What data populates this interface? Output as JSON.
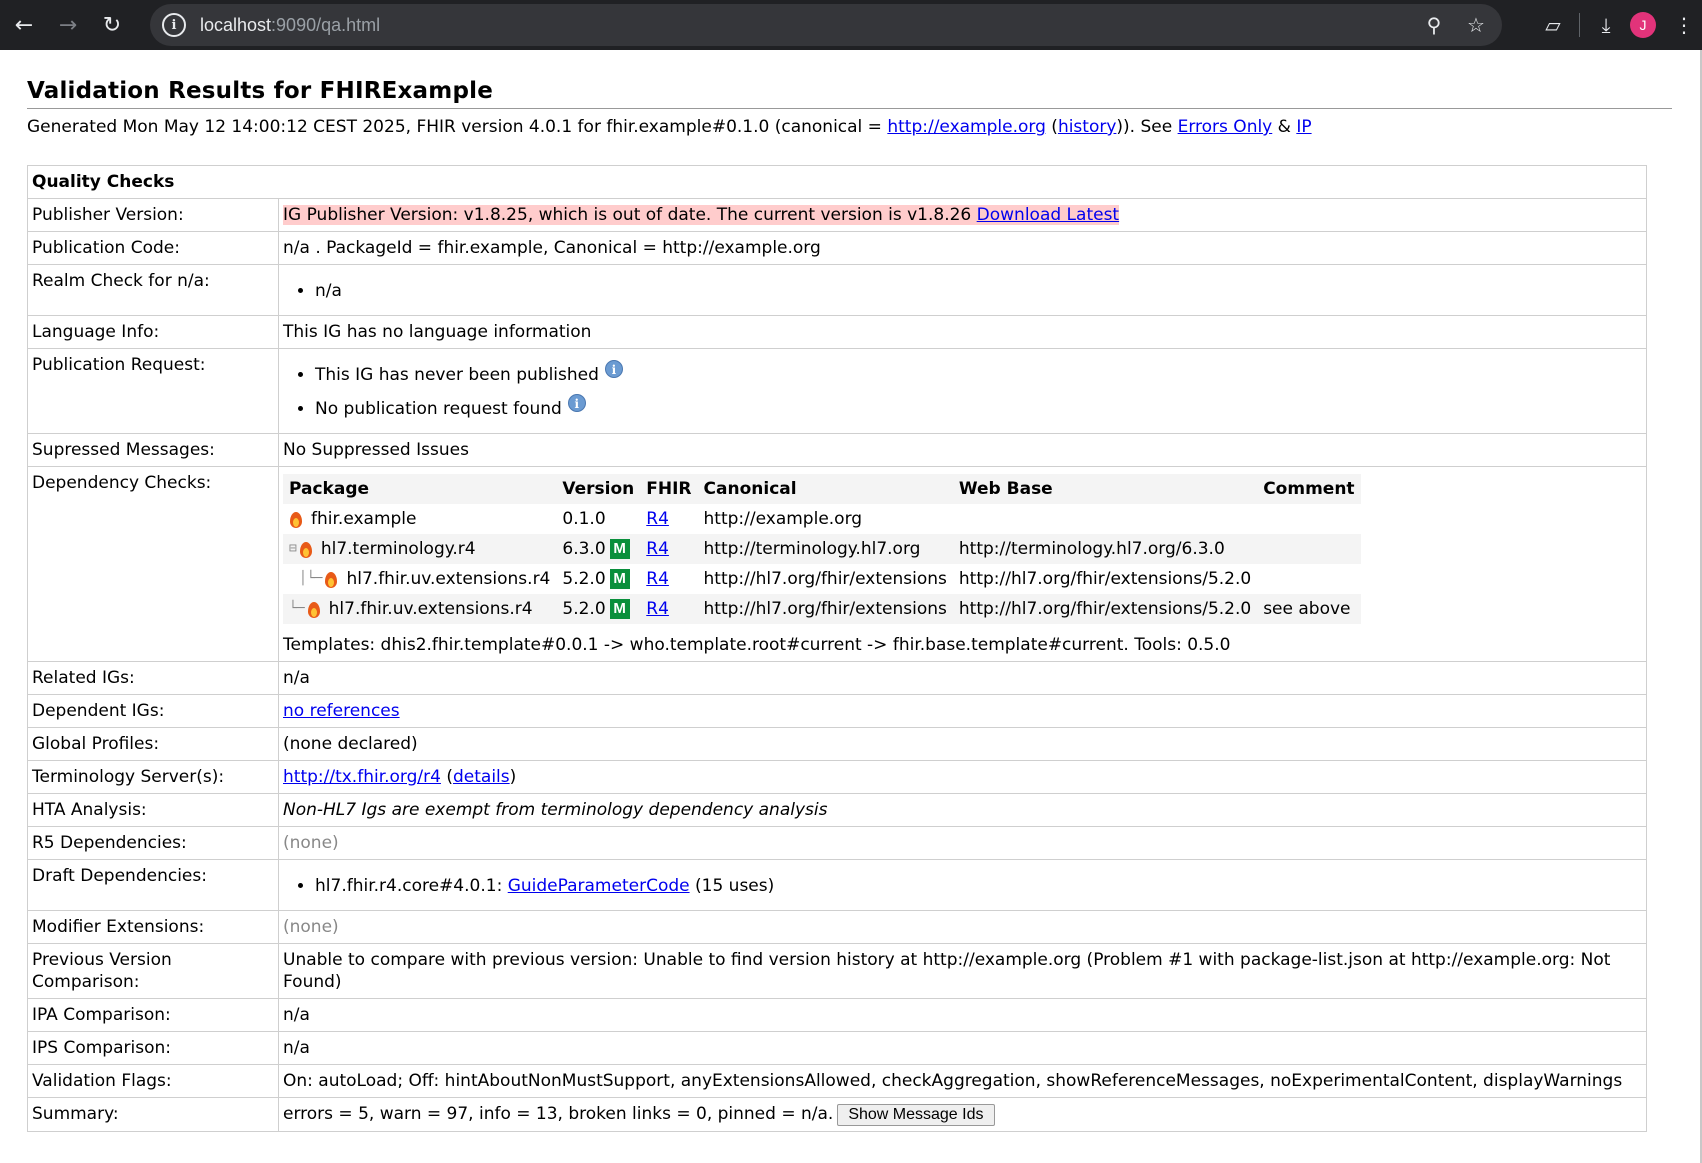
{
  "browser": {
    "url_host": "localhost",
    "url_rest": ":9090/qa.html",
    "avatar_letter": "J"
  },
  "page": {
    "title": "Validation Results for FHIRExample",
    "generated_prefix": "Generated Mon May 12 14:00:12 CEST 2025, FHIR version 4.0.1 for fhir.example#0.1.0 (canonical = ",
    "canonical_link": "http://example.org",
    "sep1": " (",
    "history_link": "history",
    "sep2": ")). See ",
    "errors_only_link": "Errors Only",
    "amp": " & ",
    "ip_link": "IP"
  },
  "quality": {
    "header": "Quality Checks",
    "publisher_version": {
      "label": "Publisher Version:",
      "text": "IG Publisher Version: v1.8.25, which is out of date. The current version is v1.8.26 ",
      "link": "Download Latest"
    },
    "publication_code": {
      "label": "Publication Code:",
      "text": "n/a . PackageId = fhir.example, Canonical = http://example.org"
    },
    "realm_check": {
      "label": "Realm Check for n/a:",
      "items": [
        "n/a"
      ]
    },
    "language_info": {
      "label": "Language Info:",
      "text": "This IG has no language information"
    },
    "publication_request": {
      "label": "Publication Request:",
      "items": [
        "This IG has never been published",
        "No publication request found"
      ]
    },
    "suppressed": {
      "label": "Supressed Messages:",
      "text": "No Suppressed Issues"
    },
    "dependency": {
      "label": "Dependency Checks:",
      "columns": [
        "Package",
        "Version",
        "FHIR",
        "Canonical",
        "Web Base",
        "Comment"
      ],
      "rows": [
        {
          "package": "fhir.example",
          "version": "0.1.0",
          "badge": "",
          "fhir": "R4",
          "canonical": "http://example.org",
          "webbase": "",
          "comment": ""
        },
        {
          "package": "hl7.terminology.r4",
          "version": "6.3.0",
          "badge": "M",
          "fhir": "R4",
          "canonical": "http://terminology.hl7.org",
          "webbase": "http://terminology.hl7.org/6.3.0",
          "comment": ""
        },
        {
          "package": "hl7.fhir.uv.extensions.r4",
          "version": "5.2.0",
          "badge": "M",
          "fhir": "R4",
          "canonical": "http://hl7.org/fhir/extensions",
          "webbase": "http://hl7.org/fhir/extensions/5.2.0",
          "comment": ""
        },
        {
          "package": "hl7.fhir.uv.extensions.r4",
          "version": "5.2.0",
          "badge": "M",
          "fhir": "R4",
          "canonical": "http://hl7.org/fhir/extensions",
          "webbase": "http://hl7.org/fhir/extensions/5.2.0",
          "comment": "see above"
        }
      ],
      "templates": "Templates: dhis2.fhir.template#0.0.1 -> who.template.root#current -> fhir.base.template#current. Tools: 0.5.0"
    },
    "related_igs": {
      "label": "Related IGs:",
      "text": "n/a"
    },
    "dependent_igs": {
      "label": "Dependent IGs:",
      "link": "no references"
    },
    "global_profiles": {
      "label": "Global Profiles:",
      "text": "(none declared)"
    },
    "terminology_servers": {
      "label": "Terminology Server(s):",
      "link": "http://tx.fhir.org/r4",
      "open": " (",
      "details_link": "details",
      "close": ")"
    },
    "hta": {
      "label": "HTA Analysis:",
      "text": "Non-HL7 Igs are exempt from terminology dependency analysis"
    },
    "r5_deps": {
      "label": "R5 Dependencies:",
      "text": "(none)"
    },
    "draft_deps": {
      "label": "Draft Dependencies:",
      "prefix": "hl7.fhir.r4.core#4.0.1: ",
      "link": "GuideParameterCode",
      "suffix": " (15 uses)"
    },
    "modifier_ext": {
      "label": "Modifier Extensions:",
      "text": "(none)"
    },
    "previous_version": {
      "label": "Previous Version Comparison:",
      "text": "Unable to compare with previous version: Unable to find version history at http://example.org (Problem #1 with package-list.json at http://example.org: Not Found)"
    },
    "ipa": {
      "label": "IPA Comparison:",
      "text": "n/a"
    },
    "ips": {
      "label": "IPS Comparison:",
      "text": "n/a"
    },
    "validation_flags": {
      "label": "Validation Flags:",
      "text": "On: autoLoad; Off: hintAboutNonMustSupport, anyExtensionsAllowed, checkAggregation, showReferenceMessages, noExperimentalContent, displayWarnings"
    },
    "summary": {
      "label": "Summary:",
      "text": "errors = 5, warn = 97, info = 13, broken links = 0, pinned = n/a.",
      "button": "Show Message Ids"
    }
  }
}
